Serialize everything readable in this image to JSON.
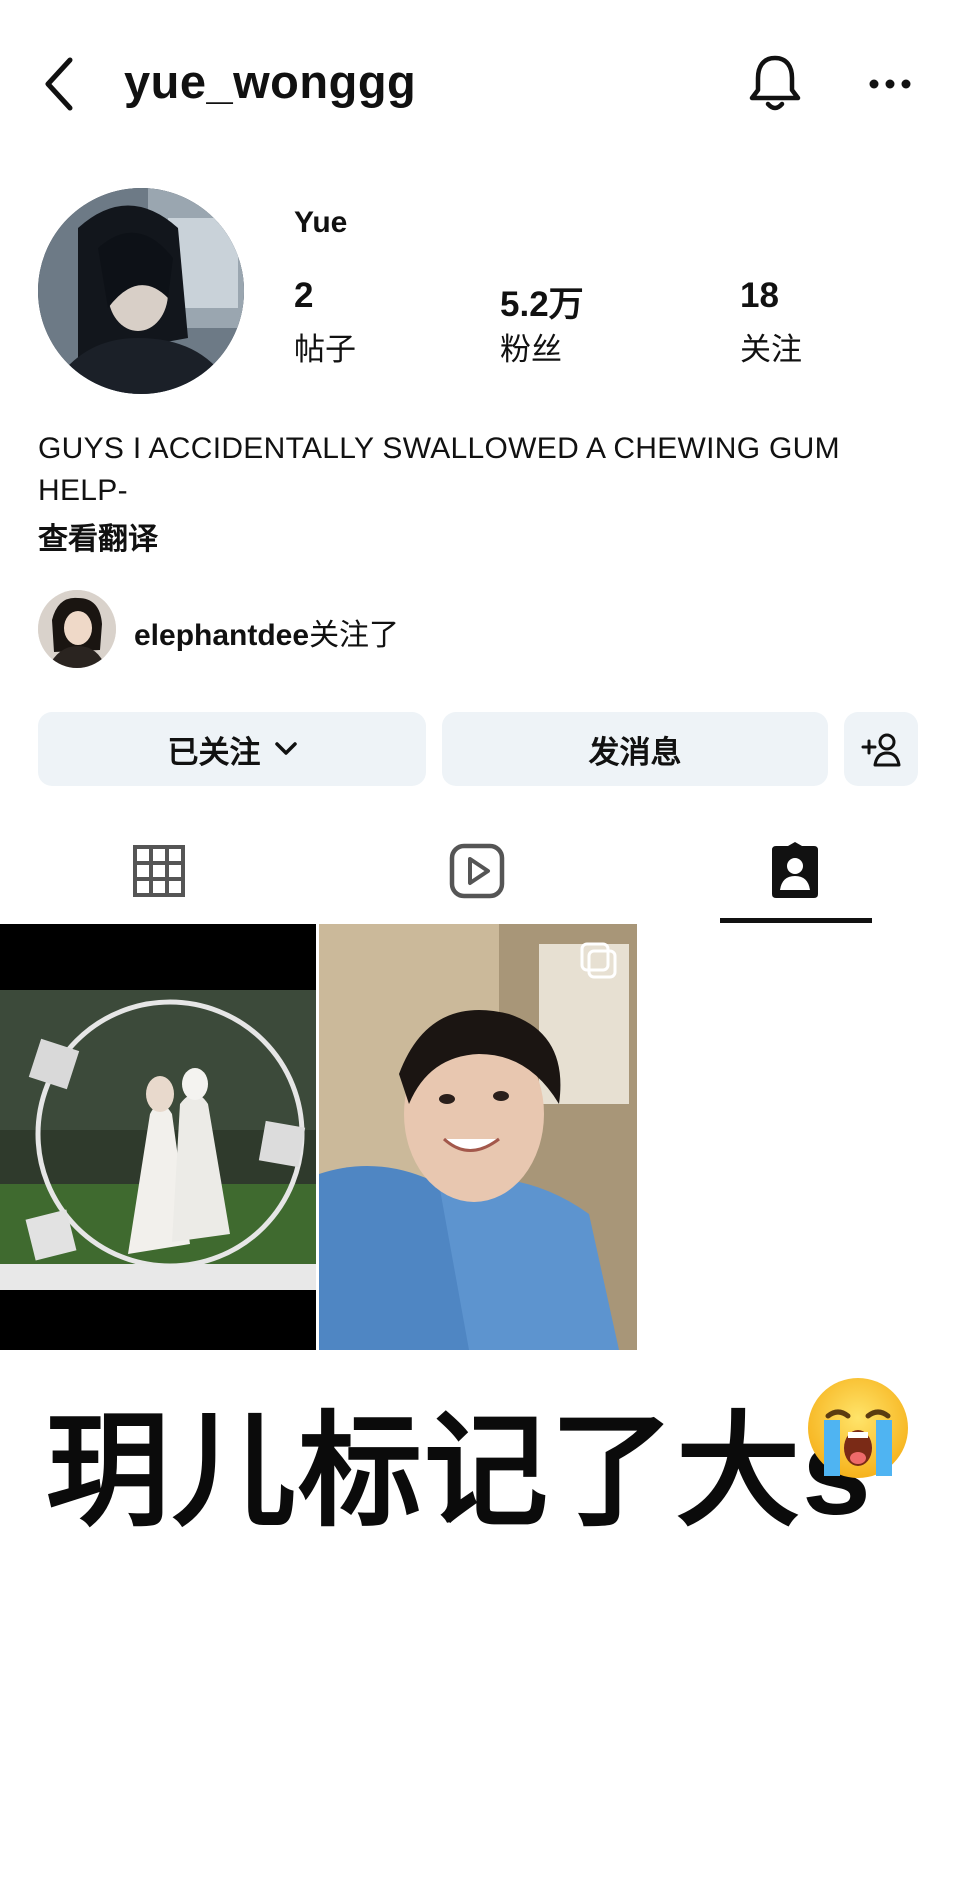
{
  "header": {
    "username": "yue_wonggg",
    "back_icon": "chevron-left-icon",
    "bell_icon": "bell-icon",
    "more_icon": "more-horizontal-icon"
  },
  "profile": {
    "display_name": "Yue",
    "stats": [
      {
        "value": "2",
        "label": "帖子"
      },
      {
        "value": "5.2万",
        "label": "粉丝"
      },
      {
        "value": "18",
        "label": "关注"
      }
    ],
    "bio": "GUYS I ACCIDENTALLY SWALLOWED A CHEWING GUM HELP-",
    "translate_link": "查看翻译",
    "followed_by_user": "elephantdee",
    "followed_by_suffix": "关注了"
  },
  "actions": {
    "following_label": "已关注",
    "message_label": "发消息",
    "add_user_icon": "add-user-icon"
  },
  "tabs": [
    {
      "name": "grid",
      "icon": "grid-icon"
    },
    {
      "name": "reels",
      "icon": "reels-icon"
    },
    {
      "name": "tagged",
      "icon": "tagged-icon",
      "active": true
    }
  ],
  "overlay_caption": "玥儿标记了大s",
  "colors": {
    "button_bg": "#eef3f7",
    "text": "#111111"
  }
}
